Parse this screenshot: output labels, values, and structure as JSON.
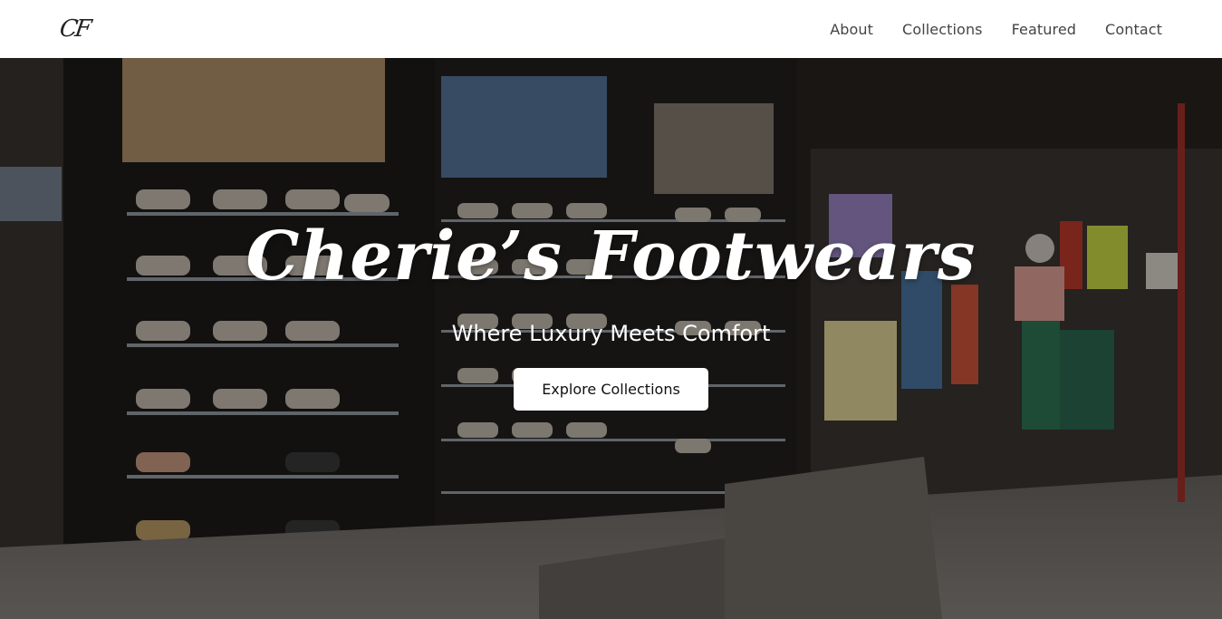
{
  "navbar": {
    "logo_text": "CF",
    "links": [
      {
        "label": "About"
      },
      {
        "label": "Collections"
      },
      {
        "label": "Featured"
      },
      {
        "label": "Contact"
      }
    ]
  },
  "hero": {
    "title": "Cherie’s Footwears",
    "subtitle": "Where Luxury Meets Comfort",
    "button_label": "Explore Collections"
  },
  "colors": {
    "nav_background": "#ffffff",
    "nav_text": "#444444",
    "hero_text": "#ffffff",
    "button_background": "#ffffff",
    "button_text": "#111111"
  }
}
